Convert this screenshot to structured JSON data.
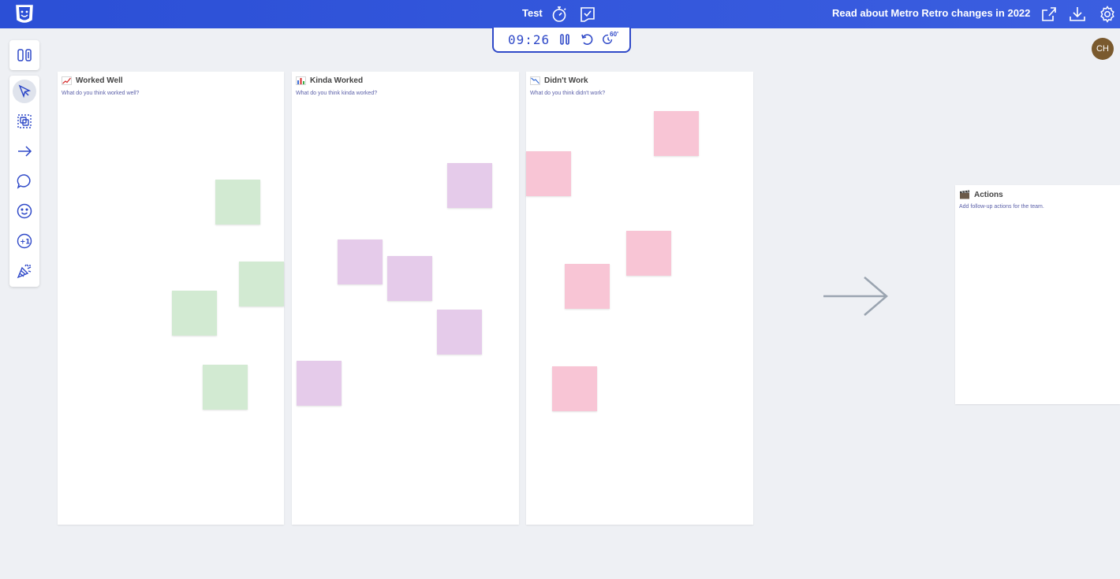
{
  "header": {
    "board_title": "Test",
    "news_link": "Read about Metro Retro changes in 2022",
    "icons": [
      "logo-icon",
      "stopwatch-icon",
      "retro-board-icon",
      "share-icon",
      "download-icon",
      "settings-icon"
    ]
  },
  "timer": {
    "value": "09:26",
    "add_time_label": "60'"
  },
  "avatar": {
    "initials": "CH",
    "color": "#7a5a2e"
  },
  "toolbar": {
    "tools": [
      "layout-tool",
      "select-tool",
      "group-tool",
      "arrow-tool",
      "comment-tool",
      "emoji-tool",
      "plus-one-tool",
      "celebrate-tool"
    ]
  },
  "columns": [
    {
      "title": "Worked Well",
      "subtitle": "What do you think worked well?",
      "icon": "trend-up-icon",
      "note_color": "#d2ead2"
    },
    {
      "title": "Kinda Worked",
      "subtitle": "What do you think kinda worked?",
      "icon": "bar-chart-icon",
      "note_color": "#e5cbea"
    },
    {
      "title": "Didn't Work",
      "subtitle": "What do you think didn't work?",
      "icon": "trend-down-icon",
      "note_color": "#f8c5d5"
    }
  ],
  "actions": {
    "title": "Actions",
    "subtitle": "Add follow-up actions for the team.",
    "icon": "clapperboard-icon"
  },
  "colors": {
    "topbar": "#2b4fd6",
    "accent": "#2f49c8",
    "canvas": "#eef0f4"
  }
}
